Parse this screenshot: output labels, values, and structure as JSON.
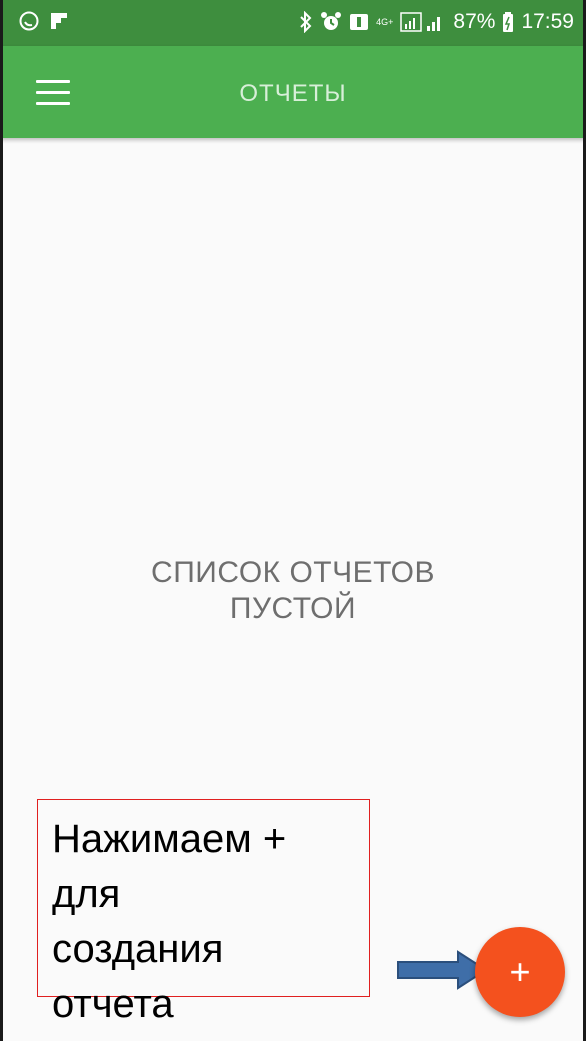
{
  "status_bar": {
    "battery_percent": "87%",
    "time": "17:59",
    "network": "4G+",
    "icons": [
      "whatsapp-icon",
      "flipboard-icon",
      "bluetooth-icon",
      "alarm-icon",
      "notification-icon",
      "signal-icon",
      "battery-icon"
    ]
  },
  "app_bar": {
    "title": "ОТЧЕТЫ",
    "menu_icon": "hamburger-menu-icon"
  },
  "main": {
    "empty_line1": "СПИСОК ОТЧЕТОВ",
    "empty_line2": "ПУСТОЙ"
  },
  "annotation": {
    "lines": [
      "Нажимаем +",
      "для",
      "создания",
      "отчета"
    ]
  },
  "fab": {
    "label": "+"
  },
  "colors": {
    "status_bar": "#3e8e3e",
    "app_bar": "#4caf50",
    "fab": "#f4511e",
    "callout_border": "#e02020",
    "arrow": "#3f6ea8"
  }
}
